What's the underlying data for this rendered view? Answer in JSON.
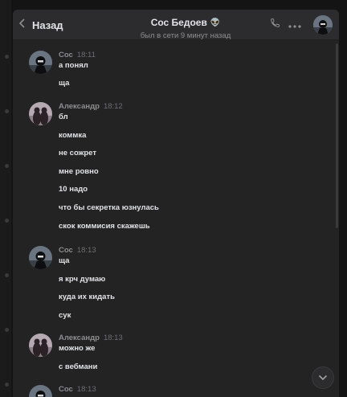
{
  "header": {
    "back_label": "Назад",
    "title": "Сос Бедоев",
    "title_emoji": "👽",
    "status": "был в сети 9 минут назад"
  },
  "icons": {
    "back": "chevron-left-icon",
    "call": "phone-icon",
    "more": "more-horizontal-icon",
    "scroll": "chevron-down-icon"
  },
  "colors": {
    "background": "#232324",
    "header": "#2c2c2e",
    "text": "#e1e3e6",
    "muted": "#8d8d8f"
  },
  "messages": {
    "groups": [
      {
        "author": "Сос",
        "time": "18:11",
        "lines": [
          "а понял",
          "ща"
        ]
      },
      {
        "author": "Александр",
        "time": "18:12",
        "lines": [
          "бл",
          "коммка",
          "не сожрет",
          "мне ровно",
          "10 надо",
          "что бы секретка юзнулась",
          "скок коммисия скажешь"
        ]
      },
      {
        "author": "Сос",
        "time": "18:13",
        "lines": [
          "ща",
          "я крч думаю",
          "куда их кидать",
          "сук"
        ]
      },
      {
        "author": "Александр",
        "time": "18:13",
        "lines": [
          "можно же",
          "с вебмани"
        ]
      },
      {
        "author": "Сос",
        "time": "18:13",
        "lines": []
      }
    ]
  }
}
